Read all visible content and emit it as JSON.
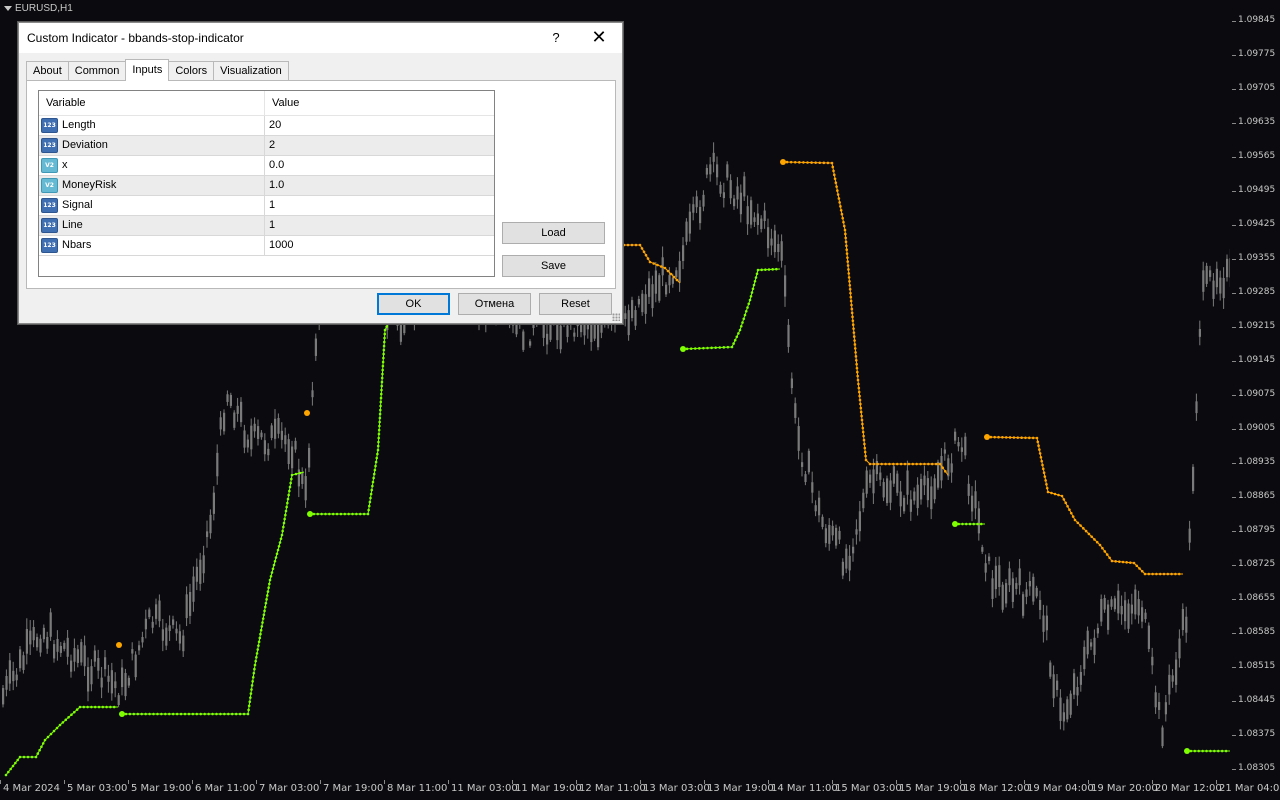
{
  "chart": {
    "symbol": "EURUSD,H1",
    "price_ticks": [
      "1.09845",
      "1.09775",
      "1.09705",
      "1.09635",
      "1.09565",
      "1.09495",
      "1.09425",
      "1.09355",
      "1.09285",
      "1.09215",
      "1.09145",
      "1.09075",
      "1.09005",
      "1.08935",
      "1.08865",
      "1.08795",
      "1.08725",
      "1.08655",
      "1.08585",
      "1.08515",
      "1.08445",
      "1.08375",
      "1.08305"
    ],
    "time_ticks": [
      "4 Mar 2024",
      "5 Mar 03:00",
      "5 Mar 19:00",
      "6 Mar 11:00",
      "7 Mar 03:00",
      "7 Mar 19:00",
      "8 Mar 11:00",
      "11 Mar 03:00",
      "11 Mar 19:00",
      "12 Mar 11:00",
      "13 Mar 03:00",
      "13 Mar 19:00",
      "14 Mar 11:00",
      "15 Mar 03:00",
      "15 Mar 19:00",
      "18 Mar 12:00",
      "19 Mar 04:00",
      "19 Mar 20:00",
      "20 Mar 12:00",
      "21 Mar 04:00"
    ],
    "colors": {
      "background": "#0b0b0f",
      "candle": "#7a7a7a",
      "up_stop": "#7fff00",
      "down_stop": "#ffa500"
    }
  },
  "dialog": {
    "title": "Custom Indicator - bbands-stop-indicator",
    "help_label": "?",
    "close_label": "✕",
    "tabs": [
      "About",
      "Common",
      "Inputs",
      "Colors",
      "Visualization"
    ],
    "active_tab": "Inputs",
    "grid": {
      "headers": {
        "variable": "Variable",
        "value": "Value"
      },
      "rows": [
        {
          "name": "Length",
          "value": "20",
          "type": "int",
          "icon": "123"
        },
        {
          "name": "Deviation",
          "value": "2",
          "type": "int",
          "icon": "123"
        },
        {
          "name": "x",
          "value": "0.0",
          "type": "double",
          "icon": "V2"
        },
        {
          "name": "MoneyRisk",
          "value": "1.0",
          "type": "double",
          "icon": "V2"
        },
        {
          "name": "Signal",
          "value": "1",
          "type": "int",
          "icon": "123"
        },
        {
          "name": "Line",
          "value": "1",
          "type": "int",
          "icon": "123"
        },
        {
          "name": "Nbars",
          "value": "1000",
          "type": "int",
          "icon": "123"
        }
      ]
    },
    "load_label": "Load",
    "save_label": "Save",
    "ok_label": "OK",
    "cancel_label": "Отмена",
    "reset_label": "Reset"
  }
}
